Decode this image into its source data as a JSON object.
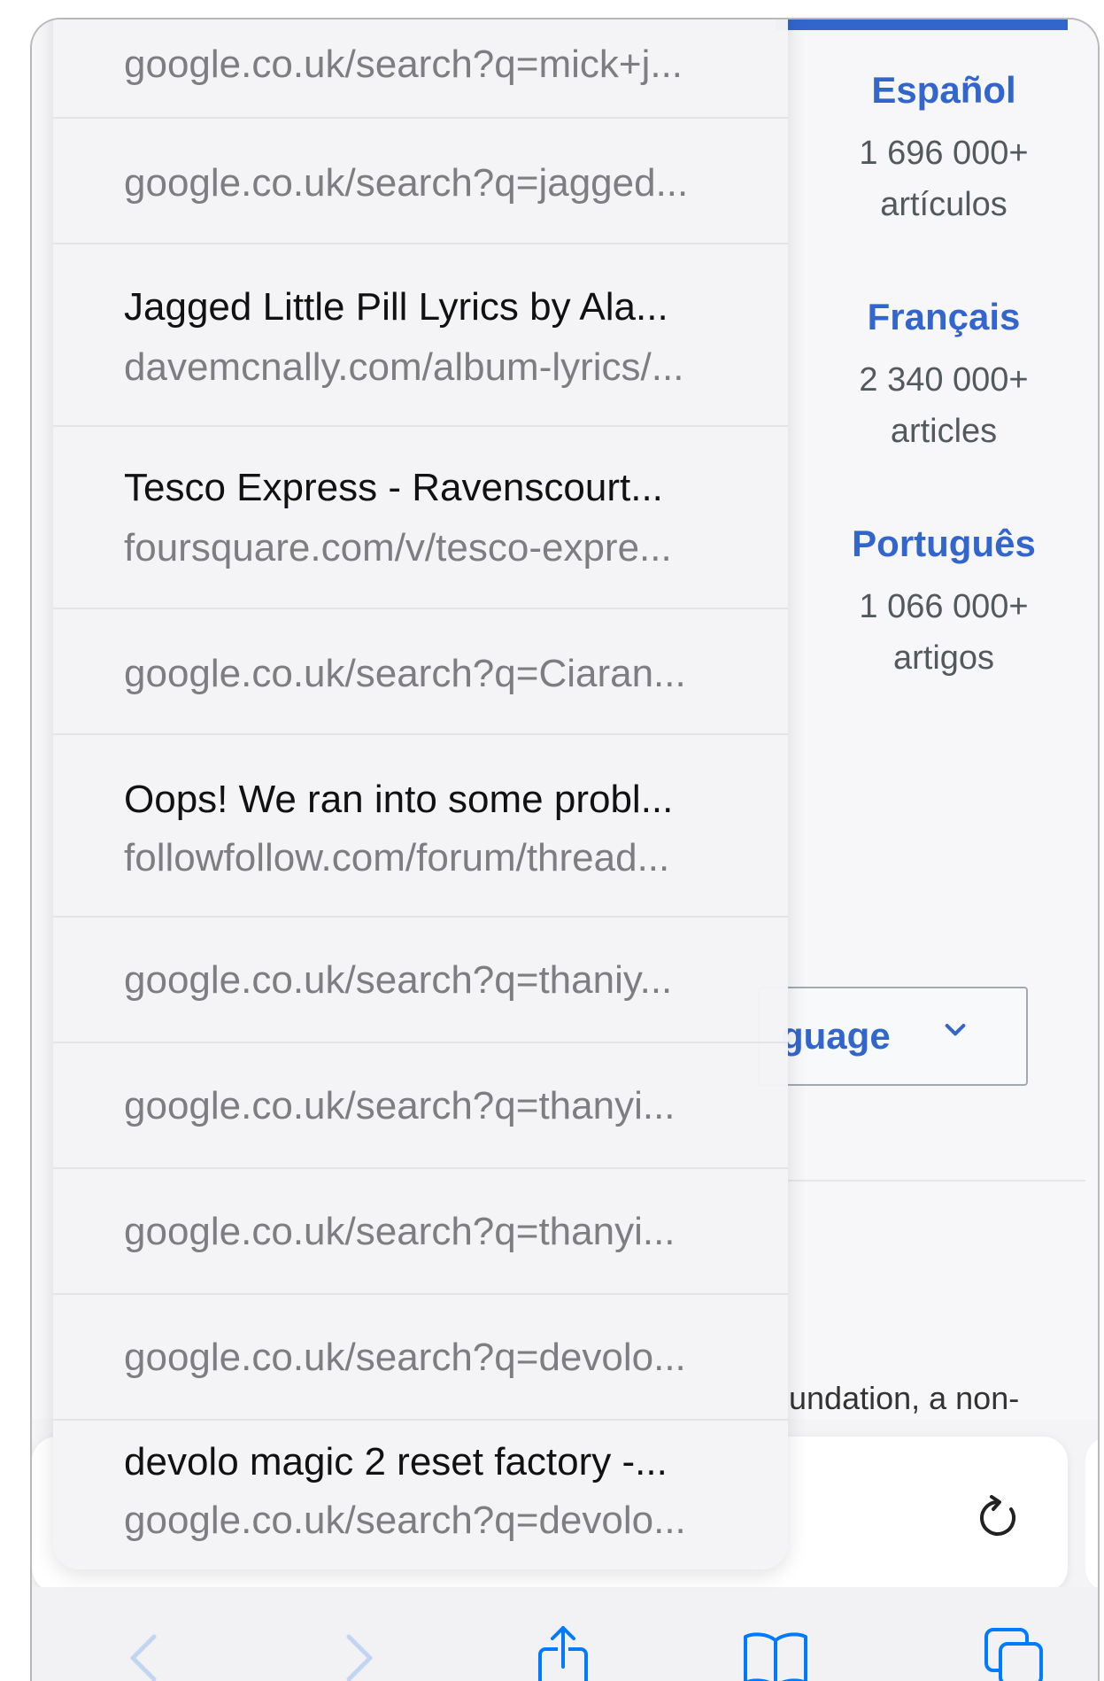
{
  "background_page": {
    "languages": [
      {
        "name": "Español",
        "count": "1 696 000+",
        "unit": "artículos"
      },
      {
        "name": "Français",
        "count": "2 340 000+",
        "unit": "articles"
      },
      {
        "name": "Português",
        "count": "1 066 000+",
        "unit": "artigos"
      }
    ],
    "language_button": "guage",
    "footer_text": "undation, a non-"
  },
  "history": [
    {
      "url": "google.co.uk/search?q=mick+j..."
    },
    {
      "url": "google.co.uk/search?q=jagged..."
    },
    {
      "title": "Jagged Little Pill Lyrics by Ala...",
      "url": "davemcnally.com/album-lyrics/..."
    },
    {
      "title": "Tesco Express - Ravenscourt...",
      "url": "foursquare.com/v/tesco-expre..."
    },
    {
      "url": "google.co.uk/search?q=Ciaran..."
    },
    {
      "title": "Oops! We ran into some probl...",
      "url": "followfollow.com/forum/thread..."
    },
    {
      "url": "google.co.uk/search?q=thaniy..."
    },
    {
      "url": "google.co.uk/search?q=thanyi..."
    },
    {
      "url": "google.co.uk/search?q=thanyi..."
    },
    {
      "url": "google.co.uk/search?q=devolo..."
    },
    {
      "title": "devolo magic 2 reset factory -...",
      "url": "google.co.uk/search?q=devolo..."
    }
  ],
  "toolbar": {
    "icons": [
      "back-icon",
      "forward-icon",
      "share-icon",
      "bookmarks-icon",
      "tabs-icon"
    ]
  },
  "address_bar": {
    "reload_icon": "reload-icon"
  },
  "colors": {
    "link_blue": "#3366cc",
    "url_gray": "#7e7e82",
    "ios_blue": "#007aff"
  }
}
